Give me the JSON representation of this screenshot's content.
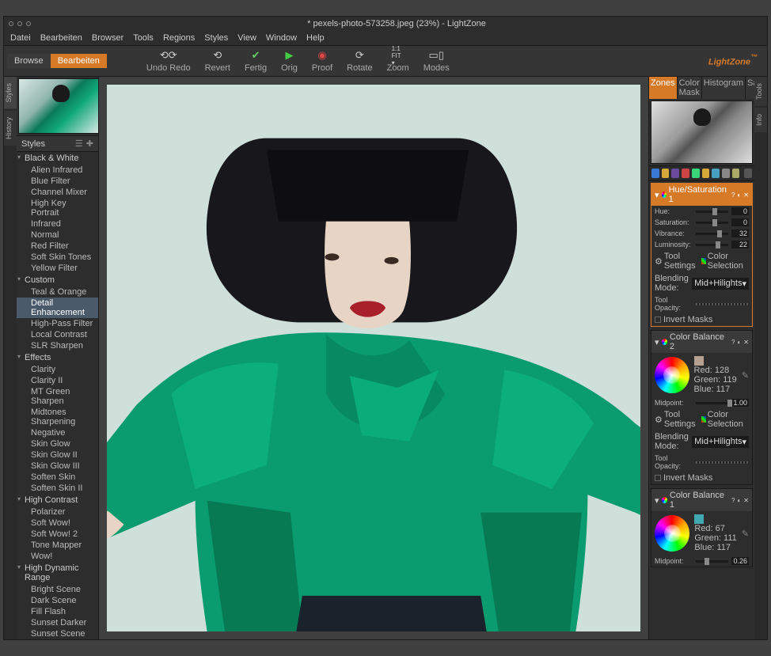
{
  "titlebar": {
    "title": "* pexels-photo-573258.jpeg (23%) - LightZone"
  },
  "menu": [
    "Datei",
    "Bearbeiten",
    "Browser",
    "Tools",
    "Regions",
    "Styles",
    "View",
    "Window",
    "Help"
  ],
  "mode_tabs": {
    "browse": "Browse",
    "edit": "Bearbeiten"
  },
  "toolbar": {
    "undoredo": "Undo Redo",
    "revert": "Revert",
    "fertig": "Fertig",
    "orig": "Orig",
    "proof": "Proof",
    "rotate": "Rotate",
    "zoom": "Zoom",
    "modes": "Modes"
  },
  "brand": "LightZone",
  "left_vtabs": [
    "Styles",
    "History"
  ],
  "styles_panel": {
    "title": "Styles"
  },
  "styles_tree": [
    {
      "type": "group",
      "label": "Black & White"
    },
    {
      "type": "item",
      "label": "Alien Infrared"
    },
    {
      "type": "item",
      "label": "Blue Filter"
    },
    {
      "type": "item",
      "label": "Channel Mixer"
    },
    {
      "type": "item",
      "label": "High Key Portrait"
    },
    {
      "type": "item",
      "label": "Infrared"
    },
    {
      "type": "item",
      "label": "Normal"
    },
    {
      "type": "item",
      "label": "Red Filter"
    },
    {
      "type": "item",
      "label": "Soft Skin Tones"
    },
    {
      "type": "item",
      "label": "Yellow Filter"
    },
    {
      "type": "group",
      "label": "Custom"
    },
    {
      "type": "item",
      "label": "Teal & Orange"
    },
    {
      "type": "item",
      "label": "Detail Enhancement",
      "selected": true
    },
    {
      "type": "item",
      "label": "High-Pass Filter"
    },
    {
      "type": "item",
      "label": "Local Contrast"
    },
    {
      "type": "item",
      "label": "SLR Sharpen"
    },
    {
      "type": "group",
      "label": "Effects"
    },
    {
      "type": "item",
      "label": "Clarity"
    },
    {
      "type": "item",
      "label": "Clarity II"
    },
    {
      "type": "item",
      "label": "MT Green Sharpen"
    },
    {
      "type": "item",
      "label": "Midtones Sharpening"
    },
    {
      "type": "item",
      "label": "Negative"
    },
    {
      "type": "item",
      "label": "Skin Glow"
    },
    {
      "type": "item",
      "label": "Skin Glow II"
    },
    {
      "type": "item",
      "label": "Skin Glow III"
    },
    {
      "type": "item",
      "label": "Soften Skin"
    },
    {
      "type": "item",
      "label": "Soften Skin II"
    },
    {
      "type": "group",
      "label": "High Contrast"
    },
    {
      "type": "item",
      "label": "Polarizer"
    },
    {
      "type": "item",
      "label": "Soft Wow!"
    },
    {
      "type": "item",
      "label": "Soft Wow! 2"
    },
    {
      "type": "item",
      "label": "Tone Mapper"
    },
    {
      "type": "item",
      "label": "Wow!"
    },
    {
      "type": "group",
      "label": "High Dynamic Range"
    },
    {
      "type": "item",
      "label": "Bright Scene"
    },
    {
      "type": "item",
      "label": "Dark Scene"
    },
    {
      "type": "item",
      "label": "Fill Flash"
    },
    {
      "type": "item",
      "label": "Sunset Darker"
    },
    {
      "type": "item",
      "label": "Sunset Scene"
    }
  ],
  "right_tabs": [
    "Zones",
    "Color Mask",
    "Histogram",
    "Sampler"
  ],
  "right_vtabs": [
    "Tools",
    "Info"
  ],
  "tool_settings_label": "Tool Settings",
  "color_selection_label": "Color Selection",
  "blending_mode_label": "Blending Mode:",
  "blending_mode_value": "Mid+Hilights",
  "tool_opacity_label": "Tool Opacity:",
  "invert_masks_label": "Invert Masks",
  "midpoint_label": "Midpoint:",
  "hsat": {
    "title": "Hue/Saturation 1",
    "hue_label": "Hue:",
    "hue_val": "0",
    "sat_label": "Saturation:",
    "sat_val": "0",
    "vib_label": "Vibrance:",
    "vib_val": "32",
    "lum_label": "Luminosity:",
    "lum_val": "22"
  },
  "cb2": {
    "title": "Color Balance 2",
    "red": "Red:  128",
    "green": "Green:  119",
    "blue": "Blue:  117",
    "swatch": "#b8a090",
    "midpoint_val": "1.00"
  },
  "cb1": {
    "title": "Color Balance 1",
    "red": "Red:  67",
    "green": "Green:  111",
    "blue": "Blue:  117",
    "swatch": "#3fa8b0",
    "midpoint_val": "0.26"
  }
}
